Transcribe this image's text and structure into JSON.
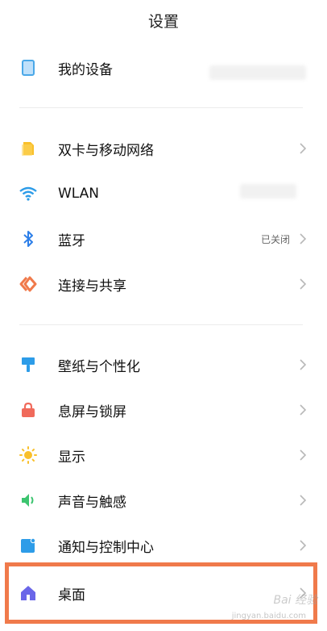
{
  "header": {
    "title": "设置"
  },
  "sections": [
    [
      {
        "label": "我的设备",
        "icon": "device-icon",
        "color": "#4aa8e8"
      }
    ],
    [
      {
        "label": "双卡与移动网络",
        "icon": "sim-card-icon",
        "color": "#f9c02b"
      },
      {
        "label": "WLAN",
        "icon": "wifi-icon",
        "color": "#2d9ce8"
      },
      {
        "label": "蓝牙",
        "icon": "bluetooth-icon",
        "color": "#2d7fe8",
        "status": "已关闭"
      },
      {
        "label": "连接与共享",
        "icon": "connection-share-icon",
        "color": "#f07a4b"
      }
    ],
    [
      {
        "label": "壁纸与个性化",
        "icon": "wallpaper-brush-icon",
        "color": "#2d9ce8"
      },
      {
        "label": "息屏与锁屏",
        "icon": "lock-icon",
        "color": "#f06a5b"
      },
      {
        "label": "显示",
        "icon": "sun-icon",
        "color": "#f9c02b"
      },
      {
        "label": "声音与触感",
        "icon": "speaker-icon",
        "color": "#3cc46f"
      },
      {
        "label": "通知与控制中心",
        "icon": "notification-icon",
        "color": "#2d9ce8"
      },
      {
        "label": "桌面",
        "icon": "home-icon",
        "color": "#6a66e8"
      }
    ]
  ],
  "watermark": {
    "brand": "Bai 经验",
    "url": "jingyan.baidu.com"
  }
}
